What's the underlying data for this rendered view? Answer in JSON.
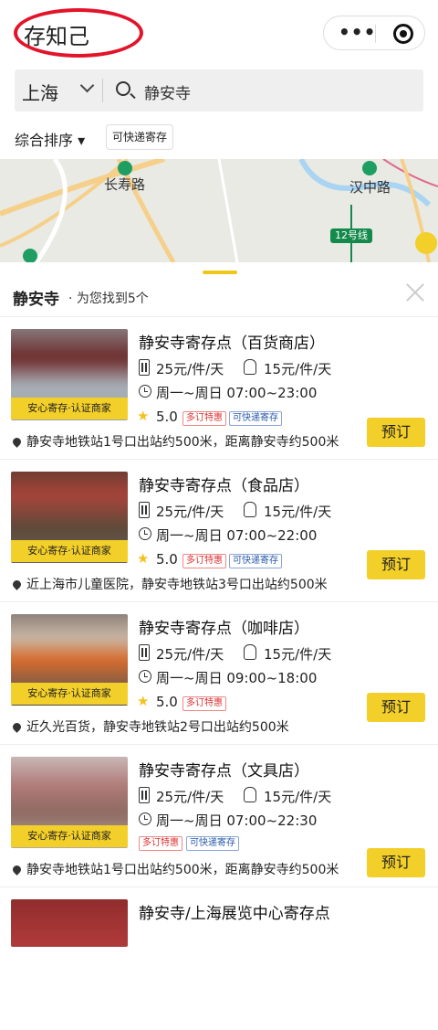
{
  "app": {
    "title": "存知己"
  },
  "search": {
    "city": "上海",
    "query": "静安寺"
  },
  "filters": {
    "sort": "综合排序 ▾",
    "express": "可快递寄存"
  },
  "map": {
    "stations": [
      "长寿路",
      "汉中路"
    ],
    "line": "12号线"
  },
  "results": {
    "title": "静安寺",
    "count": "· 为您找到5个"
  },
  "badge_text": "安心寄存·认证商家",
  "book_label": "预订",
  "cards": [
    {
      "name": "静安寺寄存点（百货商店）",
      "price_large": "25元/件/天",
      "price_small": "15元/件/天",
      "hours": "周一~周日 07:00~23:00",
      "rating": "5.0",
      "tags": [
        "多订特惠",
        "可快递寄存"
      ],
      "address": "静安寺地铁站1号口出站约500米，距离静安寺约500米"
    },
    {
      "name": "静安寺寄存点（食品店）",
      "price_large": "25元/件/天",
      "price_small": "15元/件/天",
      "hours": "周一~周日 07:00~22:00",
      "rating": "5.0",
      "tags": [
        "多订特惠",
        "可快递寄存"
      ],
      "address": "近上海市儿童医院，静安寺地铁站3号口出站约500米"
    },
    {
      "name": "静安寺寄存点（咖啡店）",
      "price_large": "25元/件/天",
      "price_small": "15元/件/天",
      "hours": "周一~周日 09:00~18:00",
      "rating": "5.0",
      "tags": [
        "多订特惠"
      ],
      "address": "近久光百货，静安寺地铁站2号口出站约500米"
    },
    {
      "name": "静安寺寄存点（文具店）",
      "price_large": "25元/件/天",
      "price_small": "15元/件/天",
      "hours": "周一~周日 07:00~22:30",
      "rating": "",
      "tags": [
        "多订特惠",
        "可快递寄存"
      ],
      "address": "静安寺地铁站1号口出站约500米，距离静安寺约500米"
    },
    {
      "name": "静安寺/上海展览中心寄存点"
    }
  ],
  "colors": {
    "accent": "#f3cf29",
    "highlight_ring": "#e3132a"
  }
}
